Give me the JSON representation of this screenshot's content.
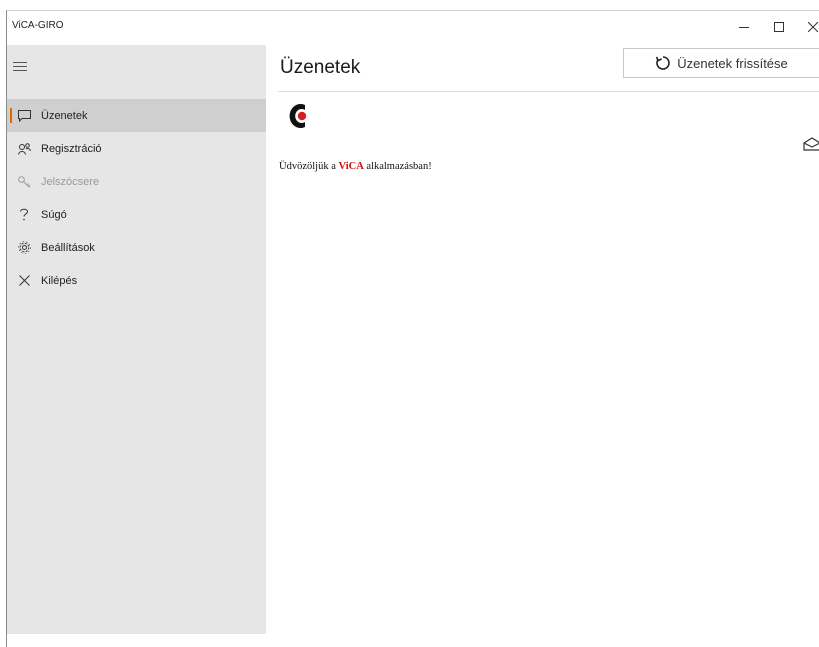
{
  "window": {
    "title": "ViCA-GIRO"
  },
  "sidebar": {
    "items": [
      {
        "label": "Üzenetek",
        "icon": "message-icon",
        "state": "selected"
      },
      {
        "label": "Regisztráció",
        "icon": "register-icon",
        "state": "normal"
      },
      {
        "label": "Jelszócsere",
        "icon": "key-icon",
        "state": "disabled"
      },
      {
        "label": "Súgó",
        "icon": "help-icon",
        "state": "normal"
      },
      {
        "label": "Beállítások",
        "icon": "gear-icon",
        "state": "normal"
      },
      {
        "label": "Kilépés",
        "icon": "close-icon",
        "state": "normal"
      }
    ]
  },
  "main": {
    "title": "Üzenetek",
    "refresh_label": "Üzenetek frissítése",
    "message": {
      "prefix": "Üdvözöljük a ",
      "brand": "ViCA",
      "suffix": " alkalmazásban!"
    }
  },
  "colors": {
    "sidebar_bg": "#e6e6e6",
    "selected_bg": "#cfcfcf",
    "accent": "#d46b08",
    "brand_red": "#cc1010"
  }
}
